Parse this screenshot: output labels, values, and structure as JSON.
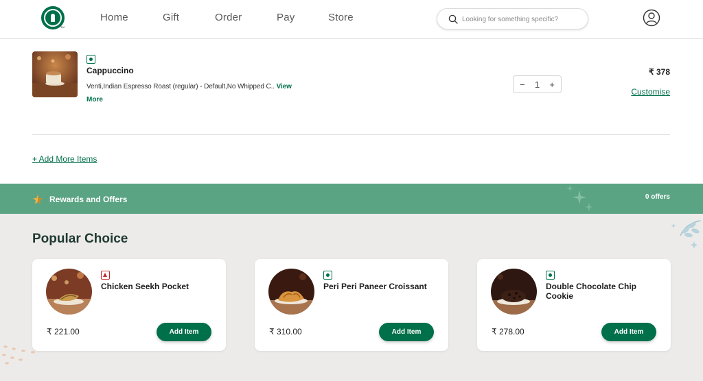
{
  "header": {
    "logo_icon": "starbucks-logo-icon",
    "nav": [
      "Home",
      "Gift",
      "Order",
      "Pay",
      "Store"
    ],
    "search": {
      "placeholder": "Looking for something specific?",
      "icon": "search-icon"
    },
    "profile_icon": "user-profile-icon"
  },
  "cart": {
    "item": {
      "veg": true,
      "name": "Cappuccino",
      "description": "Venti,Indian Espresso Roast (regular) - Default,No Whipped C..",
      "view_more_1": "View",
      "view_more_2": "More",
      "qty_minus": "−",
      "quantity": "1",
      "qty_plus": "+",
      "price": "₹ 378",
      "customise": "Customise"
    },
    "add_more": "+ Add More Items"
  },
  "rewards": {
    "icon": "star-icon",
    "label": "Rewards and Offers",
    "offers": "0 offers"
  },
  "popular": {
    "title": "Popular Choice",
    "items": [
      {
        "name": "Chicken Seekh Pocket",
        "diet": "non-veg",
        "price": "₹ 221.00",
        "button": "Add Item"
      },
      {
        "name": "Peri Peri Paneer Croissant",
        "diet": "veg",
        "price": "₹ 310.00",
        "button": "Add Item"
      },
      {
        "name": "Double Chocolate Chip Cookie",
        "diet": "veg",
        "price": "₹ 278.00",
        "button": "Add Item"
      }
    ]
  },
  "colors": {
    "brand_green": "#00704a",
    "rewards_band": "#5aa383",
    "section_bg": "#edebe9",
    "nonveg_red": "#c4262c",
    "heading_dark": "#1e3932"
  }
}
